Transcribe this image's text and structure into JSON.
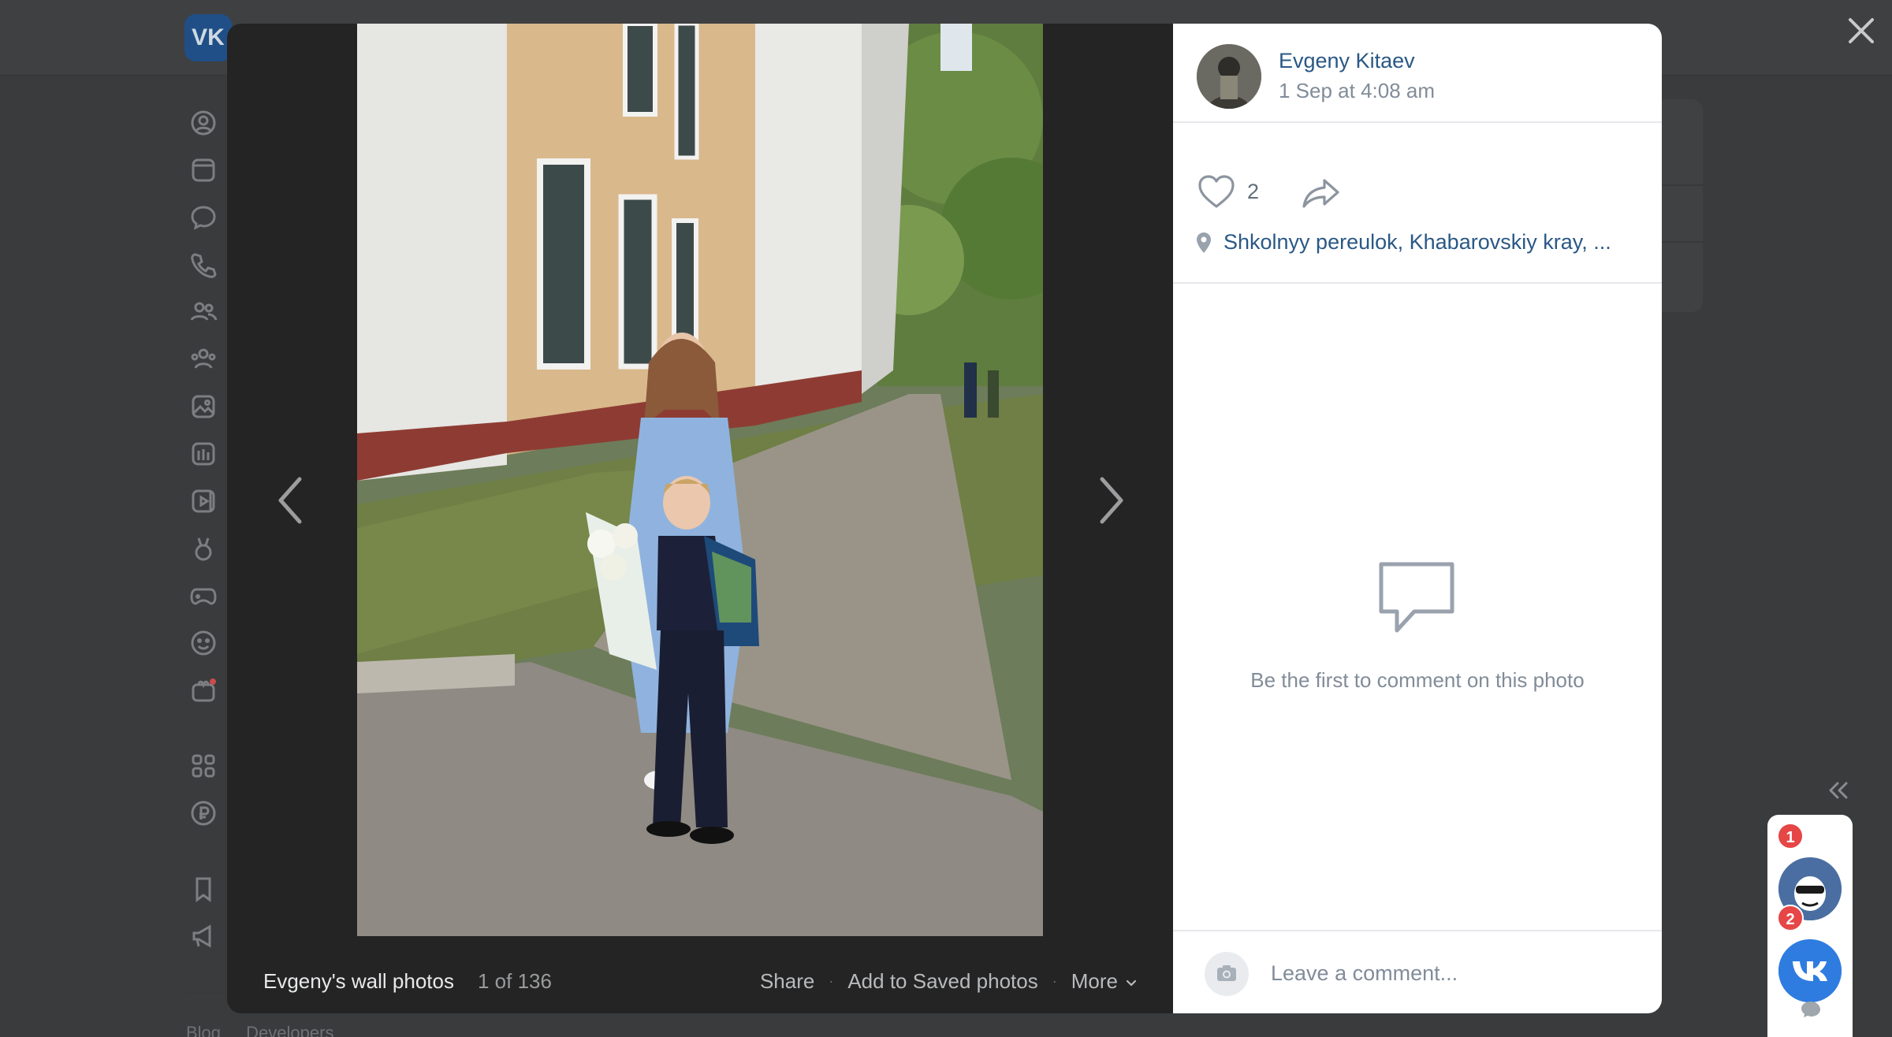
{
  "background": {
    "logo_text": "VK",
    "footer_links": [
      "Blog",
      "Developers"
    ],
    "sidebar_icons": [
      "profile-icon",
      "news-icon",
      "messenger-icon",
      "calls-icon",
      "friends-icon",
      "communities-icon",
      "photos-icon",
      "music-icon",
      "video-icon",
      "clips-icon",
      "games-icon",
      "stickers-icon",
      "gifts-icon",
      "apps-icon",
      "payments-icon",
      "bookmarks-icon",
      "ads-icon"
    ]
  },
  "viewer": {
    "album_title": "Evgeny's wall photos",
    "counter": "1 of 136",
    "actions": {
      "share": "Share",
      "save": "Add to Saved photos",
      "more": "More"
    }
  },
  "post": {
    "author_name": "Evgeny Kitaev",
    "date": "1 Sep at 4:08 am",
    "likes_count": "2",
    "location": "Shkolnyy pereulok, Khabarovskiy kray, ...",
    "empty_comments": "Be the first to comment on this photo",
    "comment_placeholder": "Leave a comment..."
  },
  "chat_widget": {
    "badges": [
      "1",
      "2"
    ]
  },
  "colors": {
    "link": "#2a5885",
    "secondary_text": "#818c99",
    "viewer_bg": "#242424",
    "badge": "#e64646",
    "vk_blue": "#2f7ce0"
  }
}
